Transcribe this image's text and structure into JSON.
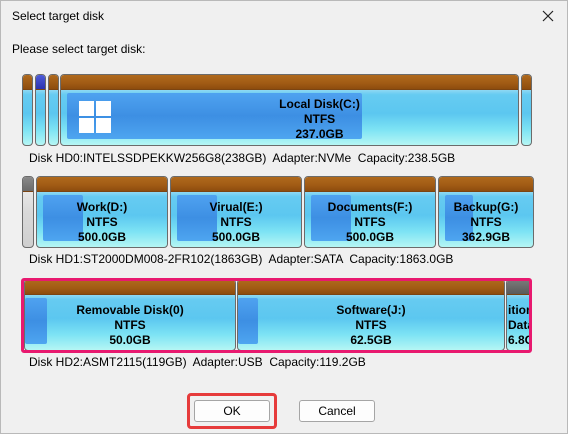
{
  "window": {
    "title": "Select target disk"
  },
  "prompt": "Please select target disk:",
  "disks": [
    {
      "partitions": [
        {
          "name": "Local Disk(C:)",
          "fs": "NTFS",
          "size": "237.0GB"
        }
      ],
      "info": "Disk HD0:INTELSSDPEKKW256G8(238GB)  Adapter:NVMe  Capacity:238.5GB"
    },
    {
      "partitions": [
        {
          "name": "Work(D:)",
          "fs": "NTFS",
          "size": "500.0GB"
        },
        {
          "name": "Virual(E:)",
          "fs": "NTFS",
          "size": "500.0GB"
        },
        {
          "name": "Documents(F:)",
          "fs": "NTFS",
          "size": "500.0GB"
        },
        {
          "name": "Backup(G:)",
          "fs": "NTFS",
          "size": "362.9GB"
        }
      ],
      "info": "Disk HD1:ST2000DM008-2FR102(1863GB)  Adapter:SATA  Capacity:1863.0GB"
    },
    {
      "partitions": [
        {
          "name": "Removable Disk(0)",
          "fs": "NTFS",
          "size": "50.0GB"
        },
        {
          "name": "Software(J:)",
          "fs": "NTFS",
          "size": "62.5GB"
        },
        {
          "name": "ition",
          "fs": "Data",
          "size": "6.8GB"
        }
      ],
      "info": "Disk HD2:ASMT2115(119GB)  Adapter:USB  Capacity:119.2GB"
    }
  ],
  "buttons": {
    "ok": "OK",
    "cancel": "Cancel"
  },
  "icons": {
    "close": "close-icon",
    "os": "windows-logo-icon"
  },
  "colors": {
    "selection": "#e8196f",
    "ok_highlight": "#e63b3b",
    "partition_cap": "#a05a14"
  }
}
